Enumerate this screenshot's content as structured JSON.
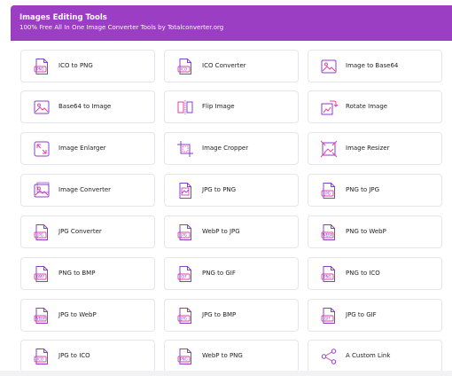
{
  "header": {
    "title": "Images Editing Tools",
    "subtitle": "100% Free All In One Image Converter Tools by Totalconverter.org",
    "accent_color": "#9b3ec4"
  },
  "tools": [
    {
      "label": "ICO to PNG",
      "icon": "ico-to-png-icon"
    },
    {
      "label": "ICO Converter",
      "icon": "ico-converter-icon"
    },
    {
      "label": "Image to Base64",
      "icon": "image-to-base64-icon"
    },
    {
      "label": "Base64 to Image",
      "icon": "base64-to-image-icon"
    },
    {
      "label": "Flip Image",
      "icon": "flip-image-icon"
    },
    {
      "label": "Rotate Image",
      "icon": "rotate-image-icon"
    },
    {
      "label": "Image Enlarger",
      "icon": "image-enlarger-icon"
    },
    {
      "label": "Image Cropper",
      "icon": "image-cropper-icon"
    },
    {
      "label": "Image Resizer",
      "icon": "image-resizer-icon"
    },
    {
      "label": "Image Converter",
      "icon": "image-converter-icon"
    },
    {
      "label": "JPG to PNG",
      "icon": "jpg-to-png-icon"
    },
    {
      "label": "PNG to JPG",
      "icon": "png-to-jpg-icon"
    },
    {
      "label": "JPG Converter",
      "icon": "jpg-converter-icon"
    },
    {
      "label": "WebP to JPG",
      "icon": "webp-to-jpg-icon"
    },
    {
      "label": "PNG to WebP",
      "icon": "png-to-webp-icon"
    },
    {
      "label": "PNG to BMP",
      "icon": "png-to-bmp-icon"
    },
    {
      "label": "PNG to GIF",
      "icon": "png-to-gif-icon"
    },
    {
      "label": "PNG to ICO",
      "icon": "png-to-ico-icon"
    },
    {
      "label": "JPG to WebP",
      "icon": "jpg-to-webp-icon"
    },
    {
      "label": "JPG to BMP",
      "icon": "jpg-to-bmp-icon"
    },
    {
      "label": "JPG to GIF",
      "icon": "jpg-to-gif-icon"
    },
    {
      "label": "JPG to ICO",
      "icon": "jpg-to-ico-icon"
    },
    {
      "label": "WebP to PNG",
      "icon": "webp-to-png-icon"
    },
    {
      "label": "A Custom Link",
      "icon": "share-link-icon"
    }
  ],
  "icon_tags": {
    "ico-to-png-icon": "PNG",
    "ico-converter-icon": "ICO",
    "jpg-to-png-icon": "",
    "png-to-jpg-icon": "JPG",
    "jpg-converter-icon": "JPG",
    "webp-to-jpg-icon": "JPG",
    "png-to-webp-icon": "WEBP",
    "png-to-bmp-icon": "BMP",
    "png-to-gif-icon": "GIF",
    "png-to-ico-icon": "PNG",
    "jpg-to-webp-icon": "WEBP",
    "jpg-to-bmp-icon": "JPG",
    "jpg-to-gif-icon": "GIF",
    "jpg-to-ico-icon": "ICO",
    "webp-to-png-icon": "PNG"
  },
  "colors": {
    "icon_primary": "#8a3fc7",
    "icon_accent": "#e23fa0",
    "card_border": "#e6e6ea",
    "label_text": "#222222"
  }
}
